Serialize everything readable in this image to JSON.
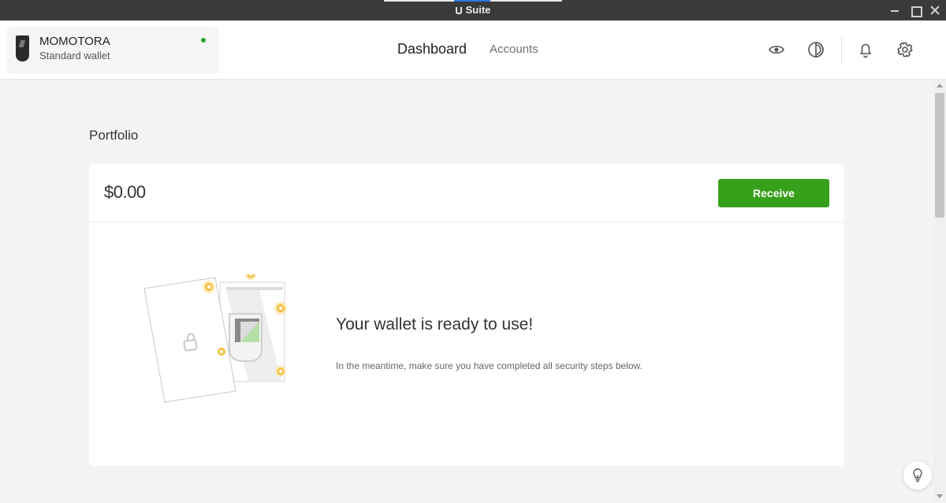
{
  "window": {
    "title": "Suite",
    "controls": {
      "minimize_icon": "minimize-icon",
      "maximize_icon": "maximize-icon",
      "close_icon": "close-icon"
    }
  },
  "header": {
    "wallet": {
      "name": "MOMOTORA",
      "type": "Standard wallet",
      "status": "connected",
      "status_color": "#2aa52a",
      "icon": "trezor-device-icon"
    },
    "nav": [
      {
        "label": "Dashboard",
        "active": true
      },
      {
        "label": "Accounts",
        "active": false
      }
    ],
    "actions": [
      "eye-icon",
      "theme-icon",
      "bell-icon",
      "gear-icon"
    ]
  },
  "main": {
    "section_title": "Portfolio",
    "balance": "$0.00",
    "receive_label": "Receive",
    "accent_color": "#37a01b",
    "empty_state": {
      "title": "Your wallet is ready to use!",
      "description": "In the meantime, make sure you have completed all security steps below."
    }
  },
  "help": {
    "icon": "lightbulb-icon"
  }
}
